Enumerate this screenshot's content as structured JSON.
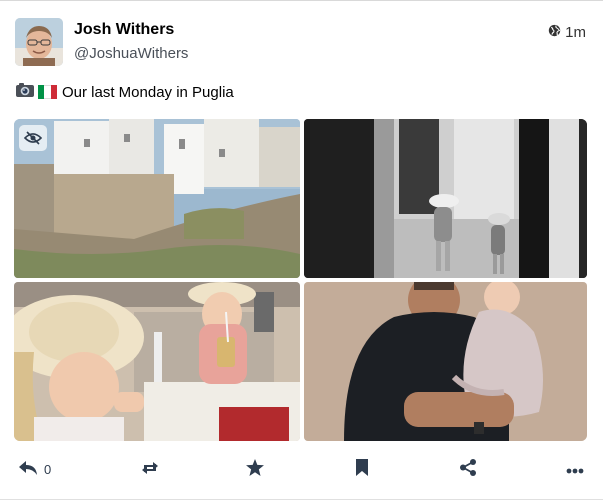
{
  "post": {
    "author_name": "Josh Withers",
    "author_handle": "@JoshuaWithers",
    "timestamp": "1m",
    "visibility_icon": "globe-icon",
    "status_emoji": "camera-icon",
    "status_text": "Our last Monday in Puglia"
  },
  "media": [
    {
      "label": "media-photo-1",
      "description_icon": "photo"
    },
    {
      "label": "media-photo-2",
      "description_icon": "photo"
    },
    {
      "label": "media-photo-3",
      "description_icon": "photo"
    },
    {
      "label": "media-photo-4",
      "description_icon": "photo"
    }
  ],
  "actions": {
    "reply_count": "0",
    "icons": [
      "reply-icon",
      "boost-icon",
      "favourite-icon",
      "bookmark-icon",
      "share-icon",
      "more-icon"
    ]
  },
  "colors": {
    "accent": "#2f3d4f",
    "handle": "#4a5059",
    "flag_green": "#009246",
    "flag_white": "#ffffff",
    "flag_red": "#ce2b37"
  }
}
